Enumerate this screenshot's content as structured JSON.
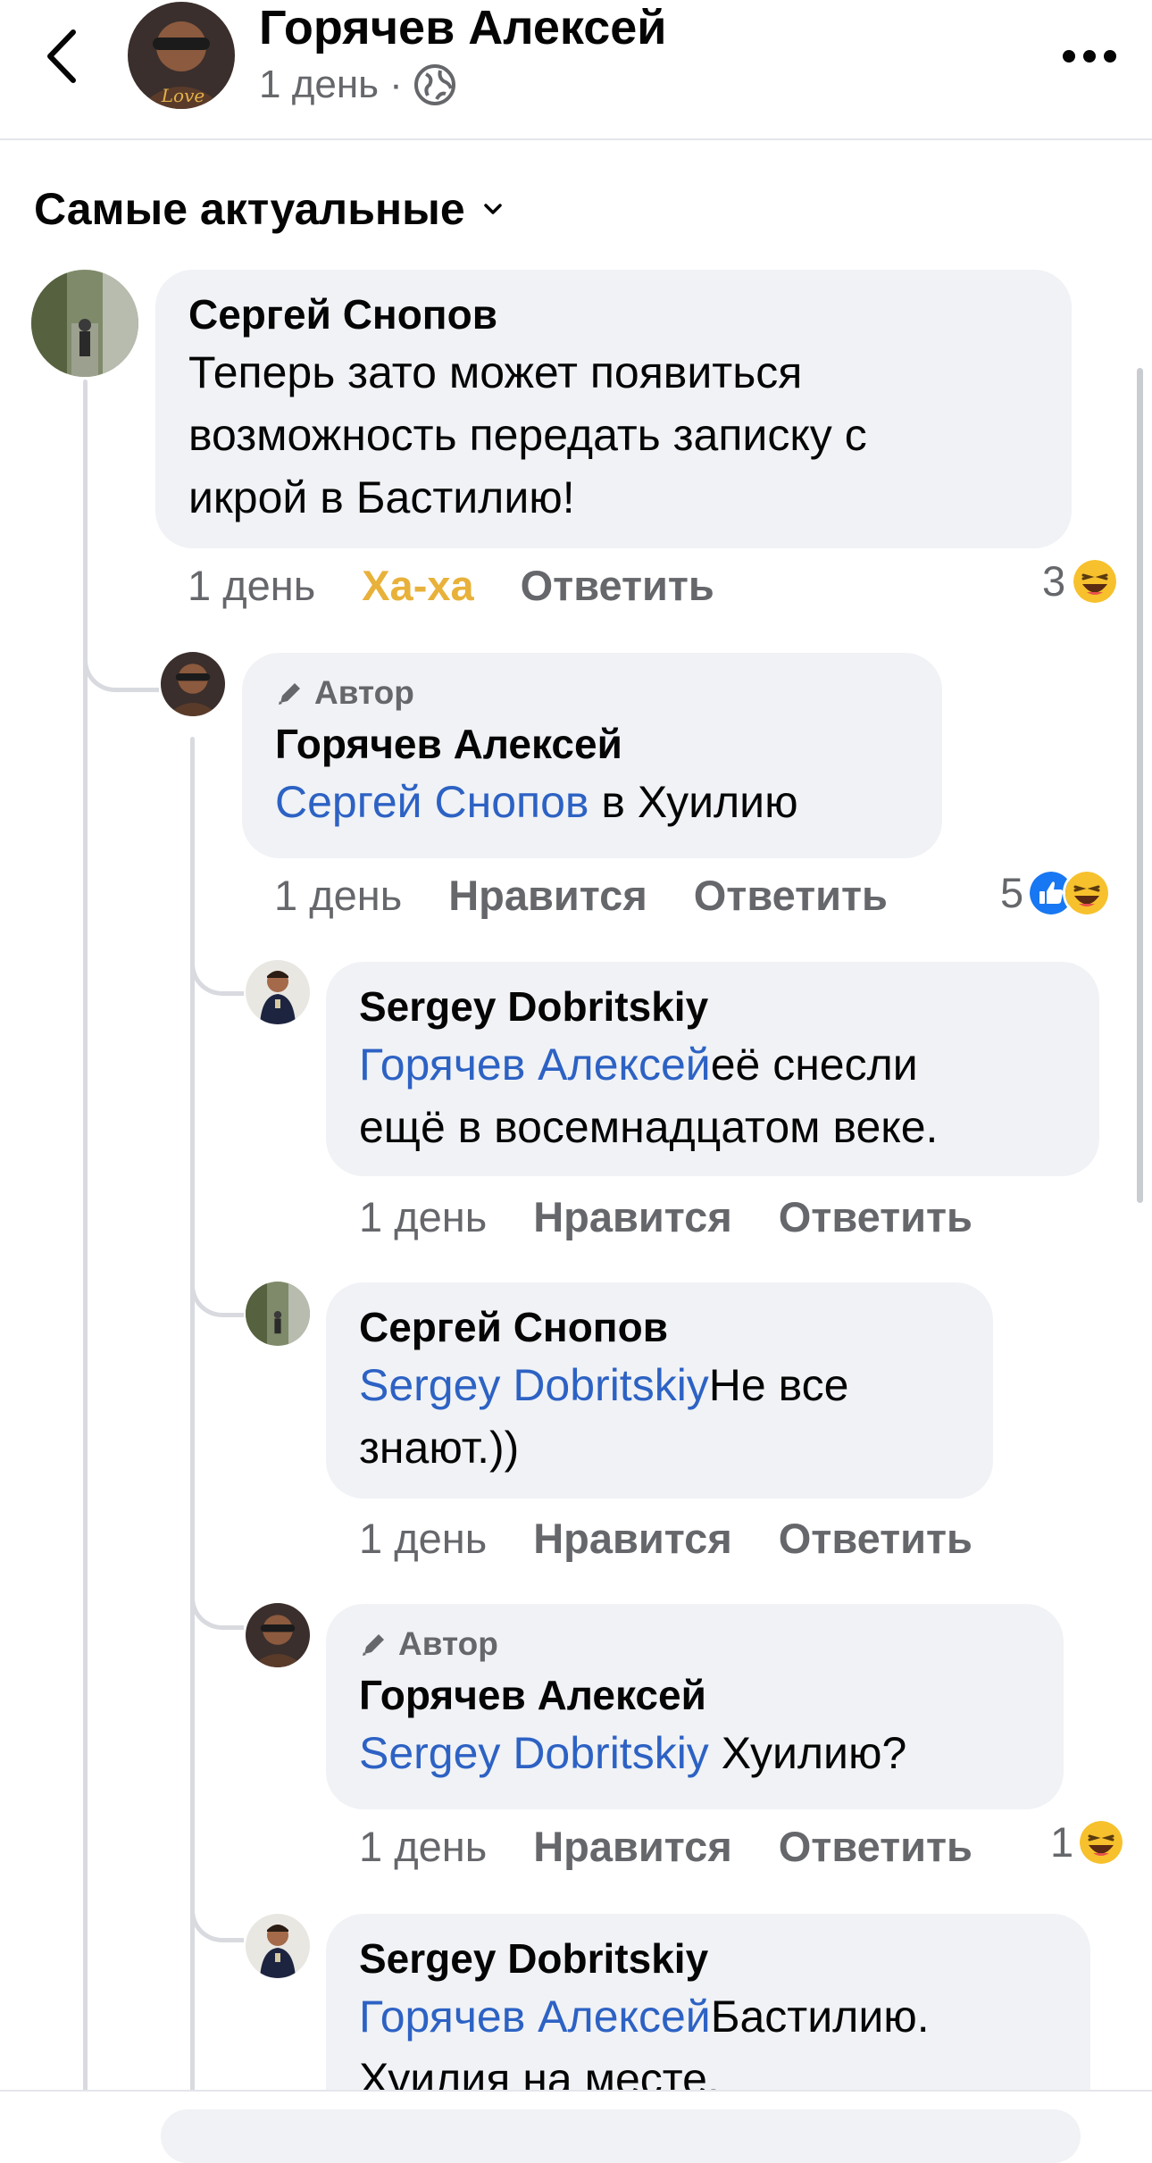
{
  "header": {
    "name": "Горячев Алексей",
    "time": "1 день",
    "separator": "·",
    "icons": {
      "back": "chevron-left-icon",
      "privacy": "globe-icon",
      "more": "more-dots-icon"
    }
  },
  "sort": {
    "label": "Самые актуальные",
    "icon": "chevron-down-icon"
  },
  "labels": {
    "author_badge": "Автор"
  },
  "colors": {
    "mention": "#2d62c4",
    "haha": "#e8b13a",
    "like_blue": "#1877f2",
    "bubble": "#f0f2f5",
    "muted": "#65676b"
  },
  "comments": [
    {
      "name": "Сергей Снопов",
      "text_lines": [
        "Теперь зато может появиться",
        "возможность передать записку с",
        "икрой в Бастилию!"
      ],
      "time": "1 день",
      "reaction_label": "Ха-ха",
      "reply_label": "Ответить",
      "reaction_count": "3",
      "reaction_icons": [
        "haha-emoji-icon"
      ]
    },
    {
      "author_badge": true,
      "name": "Горячев Алексей",
      "mention": "Сергей Снопов",
      "text": " в Хуилию",
      "time": "1 день",
      "reaction_label": "Нравится",
      "reply_label": "Ответить",
      "reaction_count": "5",
      "reaction_icons": [
        "like-emoji-icon",
        "haha-emoji-icon"
      ]
    },
    {
      "name": "Sergey Dobritskiy",
      "mention": "Горячев Алексей",
      "text_lines": [
        "её снесли",
        "ещё в восемнадцатом веке."
      ],
      "time": "1 день",
      "reaction_label": "Нравится",
      "reply_label": "Ответить"
    },
    {
      "name": "Сергей Снопов",
      "mention": "Sergey Dobritskiy",
      "text_lines": [
        "Не все",
        "знают.))"
      ],
      "time": "1 день",
      "reaction_label": "Нравится",
      "reply_label": "Ответить"
    },
    {
      "author_badge": true,
      "name": "Горячев Алексей",
      "mention": "Sergey Dobritskiy",
      "text": " Хуилию?",
      "time": "1 день",
      "reaction_label": "Нравится",
      "reply_label": "Ответить",
      "reaction_count": "1",
      "reaction_icons": [
        "haha-emoji-icon"
      ]
    },
    {
      "name": "Sergey Dobritskiy",
      "mention": "Горячев Алексей",
      "text_lines": [
        "Бастилию.",
        "Хуилия на месте."
      ]
    }
  ]
}
